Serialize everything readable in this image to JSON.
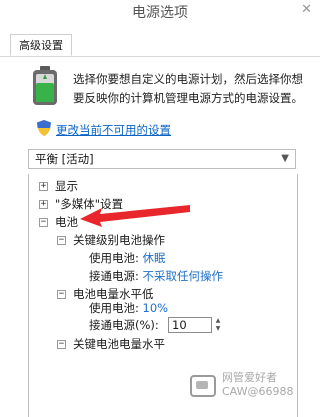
{
  "window": {
    "title": "电源选项",
    "close_glyph": "✕"
  },
  "tabs": [
    {
      "label": "高级设置"
    }
  ],
  "intro": {
    "text": "选择你要想自定义的电源计划，然后选择你想要反映你的计算机管理电源方式的电源设置。",
    "icon": "battery-icon"
  },
  "change_link": {
    "text": "更改当前不可用的设置",
    "icon": "shield-icon"
  },
  "plan_select": {
    "value": "平衡 [活动]"
  },
  "tree": {
    "display": {
      "label": "显示",
      "toggle": "+"
    },
    "multimedia": {
      "label": "\"多媒体\"设置",
      "toggle": "+"
    },
    "battery": {
      "label": "电池",
      "toggle": "−"
    },
    "critical_action": {
      "label": "关键级别电池操作",
      "toggle": "−",
      "on_battery_label": "使用电池:",
      "on_battery_value": "休眠",
      "plugged_label": "接通电源:",
      "plugged_value": "不采取任何操作"
    },
    "low_level": {
      "label": "电池电量水平低",
      "toggle": "−",
      "on_battery_label": "使用电池:",
      "on_battery_value": "10%",
      "plugged_label": "接通电源(%):",
      "plugged_value": "10"
    },
    "critical_level": {
      "label": "关键电池电量水平",
      "toggle": "−"
    }
  },
  "annotation": {
    "arrow_color": "#e8262b"
  },
  "watermark": {
    "line1": "网管爱好者",
    "line2": "CAW@66988"
  },
  "colors": {
    "link": "#0a64c8",
    "value": "#1f6fcc"
  }
}
